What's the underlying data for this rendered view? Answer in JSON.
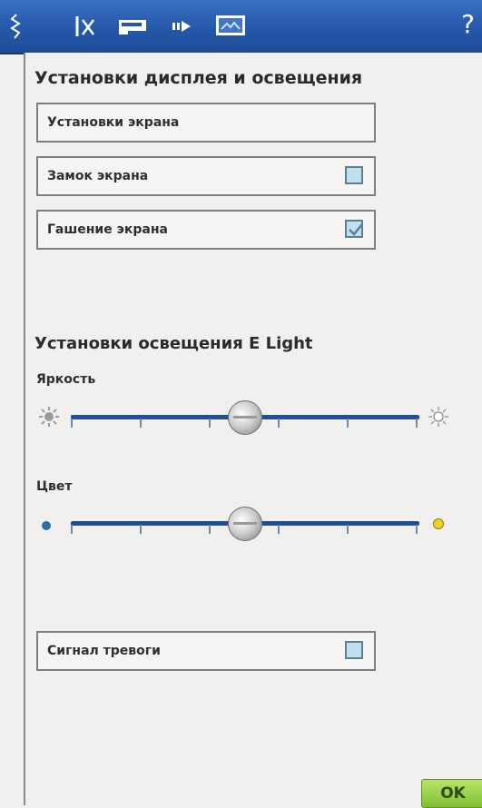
{
  "toolbar": {
    "icons": [
      "stitch-menu-icon",
      "settings-icon",
      "machine-settings-icon",
      "sound-icon",
      "display-icon"
    ],
    "help_label": "?"
  },
  "section_display": {
    "title": "Установки дисплея и освещения",
    "items": [
      {
        "label": "Установки экрана"
      },
      {
        "label": "Замок экрана",
        "checked": false
      },
      {
        "label": "Гашение экрана",
        "checked": true
      }
    ]
  },
  "section_elight": {
    "title": "Установки освещения E Light",
    "brightness": {
      "label": "Яркость",
      "value_fraction": 0.5
    },
    "color": {
      "label": "Цвет",
      "value_fraction": 0.5
    }
  },
  "alarm": {
    "label": "Сигнал тревоги",
    "checked": false
  },
  "ok_label": "OK",
  "colors": {
    "accent": "#2456a8",
    "ok_green": "#8cc63f",
    "checkbox": "#bfe0ec"
  }
}
